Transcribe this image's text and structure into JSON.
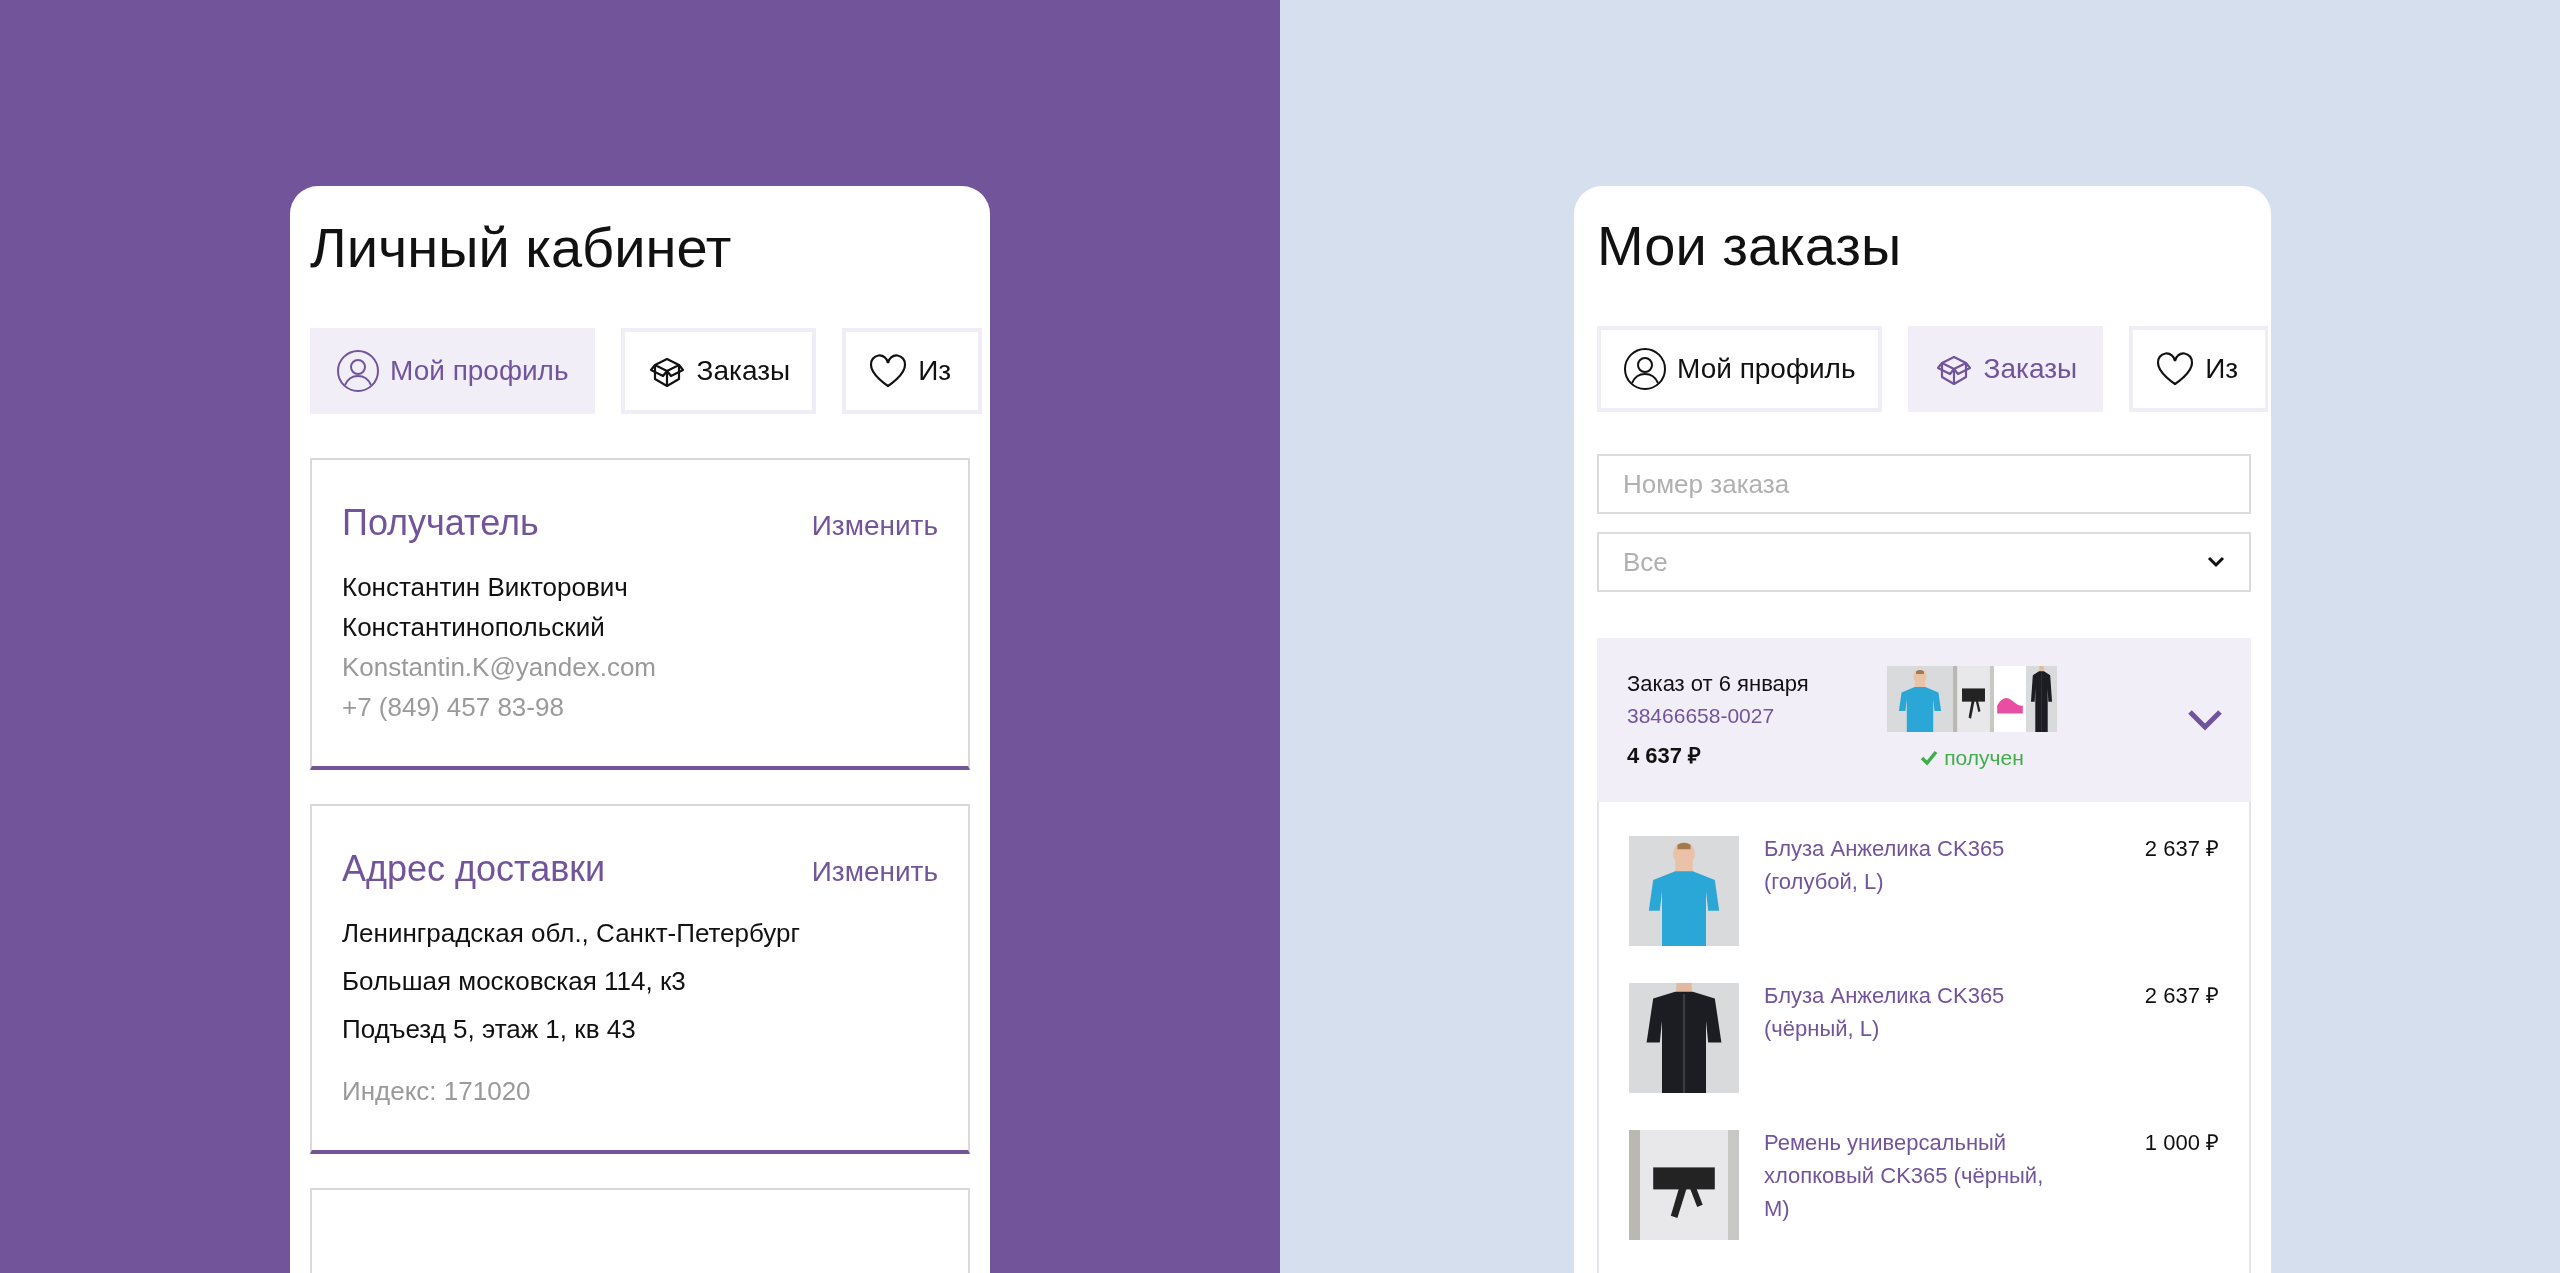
{
  "profile_screen": {
    "title": "Личный кабинет",
    "tabs": [
      {
        "kind": "profile",
        "label": "Мой профиль",
        "selected": true
      },
      {
        "kind": "orders",
        "label": "Заказы",
        "selected": false
      },
      {
        "kind": "favorites",
        "label": "Из",
        "selected": false
      }
    ],
    "cards": [
      {
        "title": "Получатель",
        "action": "Изменить",
        "lines": [
          {
            "text": "Константин Викторович",
            "muted": false
          },
          {
            "text": "Константинопольский",
            "muted": false
          },
          {
            "text": "Konstantin.K@yandex.com",
            "muted": true
          },
          {
            "text": "+7 (849) 457 83-98",
            "muted": true
          }
        ]
      },
      {
        "title": "Адрес доставки",
        "action": "Изменить",
        "lines": [
          {
            "text": "Ленинградская обл., Санкт-Петербург",
            "muted": false
          },
          {
            "text": "Большая московская 114, к3",
            "muted": false
          },
          {
            "text": "Подъезд 5, этаж 1, кв 43",
            "muted": false
          },
          {
            "text": "Индекс: 171020",
            "muted": true
          }
        ]
      }
    ]
  },
  "orders_screen": {
    "title": "Мои заказы",
    "tabs": [
      {
        "kind": "profile",
        "label": "Мой профиль",
        "selected": false
      },
      {
        "kind": "orders",
        "label": "Заказы",
        "selected": true
      },
      {
        "kind": "favorites",
        "label": "Из",
        "selected": false
      }
    ],
    "search": {
      "placeholder": "Номер заказа"
    },
    "filter": {
      "value": "Все"
    },
    "order": {
      "title": "Заказ от 6 января",
      "number": "38466658-0027",
      "total": "4 637 ₽",
      "status": {
        "label": "получен",
        "kind": "received"
      },
      "expanded": true,
      "items": [
        {
          "name": "Блуза Анжелика CK365 (голубой, L)",
          "price": "2 637 ₽",
          "kind": "blue-shirt"
        },
        {
          "name": "Блуза Анжелика CK365 (чёрный, L)",
          "price": "2 637 ₽",
          "kind": "black-shirt"
        },
        {
          "name": "Ремень универсальный хлопковый CK365 (чёрный, M)",
          "price": "1 000 ₽",
          "kind": "belt"
        }
      ]
    }
  }
}
